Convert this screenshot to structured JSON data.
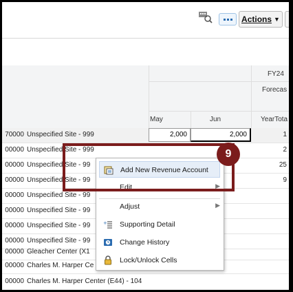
{
  "toolbar": {
    "actions_label": "Actions",
    "find_icon": "find-icon",
    "more_icon": "more-dots-icon"
  },
  "grid": {
    "header": {
      "year": "FY24",
      "scenario": "Forecas",
      "months": [
        "May",
        "Jun"
      ],
      "year_total": "YearTota"
    },
    "rows": [
      {
        "code": "70000",
        "name": "Unspecified Site - 999",
        "may": "2,000",
        "jun": "2,000",
        "year_total": "1"
      },
      {
        "code": "00000",
        "name": "Unspecified Site - 999",
        "year_total": "2"
      },
      {
        "code": "00000",
        "name": "Unspecified Site - 99",
        "year_total": "25"
      },
      {
        "code": "00000",
        "name": "Unspecified Site - 99",
        "year_total": "9"
      },
      {
        "code": "00000",
        "name": "Unspecified Site - 99"
      },
      {
        "code": "00000",
        "name": "Unspecified Site - 99"
      },
      {
        "code": "00000",
        "name": "Unspecified Site - 99"
      },
      {
        "code": "00000",
        "name": "Unspecified Site - 99"
      },
      {
        "code": "00000",
        "name": "Gleacher Center (X1"
      },
      {
        "code": "00000",
        "name": "Charles M. Harper Ce"
      },
      {
        "code": "00000",
        "name": "Charles M. Harper Center (E44) - 104"
      }
    ]
  },
  "context_menu": {
    "items": [
      {
        "label": "Add New Revenue Account",
        "icon": "add-account-icon"
      },
      {
        "label": "Edit",
        "has_submenu": true
      },
      {
        "label": "Adjust",
        "has_submenu": true
      },
      {
        "label": "Supporting Detail",
        "icon": "supporting-detail-icon"
      },
      {
        "label": "Change History",
        "icon": "change-history-icon"
      },
      {
        "label": "Lock/Unlock Cells",
        "icon": "lock-icon"
      }
    ]
  },
  "callout": {
    "number": "9",
    "color": "#7b1c1c"
  }
}
